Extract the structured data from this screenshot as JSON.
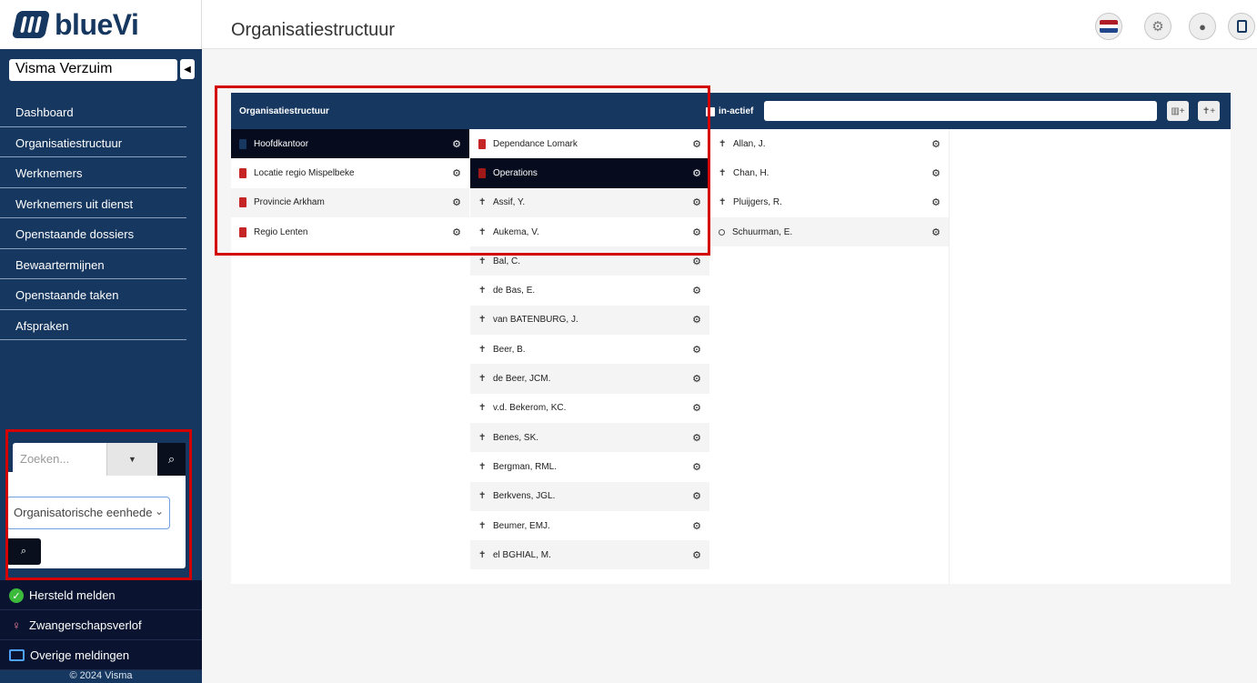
{
  "brand": {
    "name": "blueVi"
  },
  "sidebar": {
    "org_selector": "Visma Verzuim",
    "nav": [
      {
        "label": "Dashboard"
      },
      {
        "label": "Organisatiestructuur"
      },
      {
        "label": "Werknemers"
      },
      {
        "label": "Werknemers uit dienst"
      },
      {
        "label": "Openstaande dossiers"
      },
      {
        "label": "Bewaartermijnen"
      },
      {
        "label": "Openstaande taken"
      },
      {
        "label": "Afspraken"
      }
    ],
    "search": {
      "placeholder": "Zoeken...",
      "type_select": "Organisatorische eenhede"
    },
    "bottom_links": [
      {
        "label": "Hersteld melden",
        "icon": "check-circle-icon"
      },
      {
        "label": "Zwangerschapsverlof",
        "icon": "pregnant-icon"
      },
      {
        "label": "Overige meldingen",
        "icon": "list-icon"
      }
    ],
    "footer": "© 2024 Visma"
  },
  "header": {
    "title": "Organisatiestructuur",
    "flag_colors": [
      "#ae1c28",
      "#ffffff",
      "#21468b"
    ]
  },
  "panel": {
    "title": "Organisatiestructuur",
    "inactive_label": "in-actief",
    "col1": [
      {
        "label": "Hoofdkantoor",
        "selected": true
      },
      {
        "label": "Locatie regio Mispelbeke"
      },
      {
        "label": "Provincie Arkham"
      },
      {
        "label": "Regio Lenten"
      }
    ],
    "col2_units": [
      {
        "label": "Dependance Lomark"
      },
      {
        "label": "Operations",
        "selected": true
      }
    ],
    "col2_people": [
      "Assif, Y.",
      "Aukema, V.",
      "Bal, C.",
      "de Bas, E.",
      "van BATENBURG, J.",
      "Beer, B.",
      "de Beer, JCM.",
      "v.d. Bekerom, KC.",
      "Benes, SK.",
      "Bergman, RML.",
      "Berkvens, JGL.",
      "Beumer, EMJ.",
      "el BGHIAL, M."
    ],
    "col3_people": [
      "Allan, J.",
      "Chan, H.",
      "Pluijgers, R.",
      "Schuurman, E."
    ]
  }
}
